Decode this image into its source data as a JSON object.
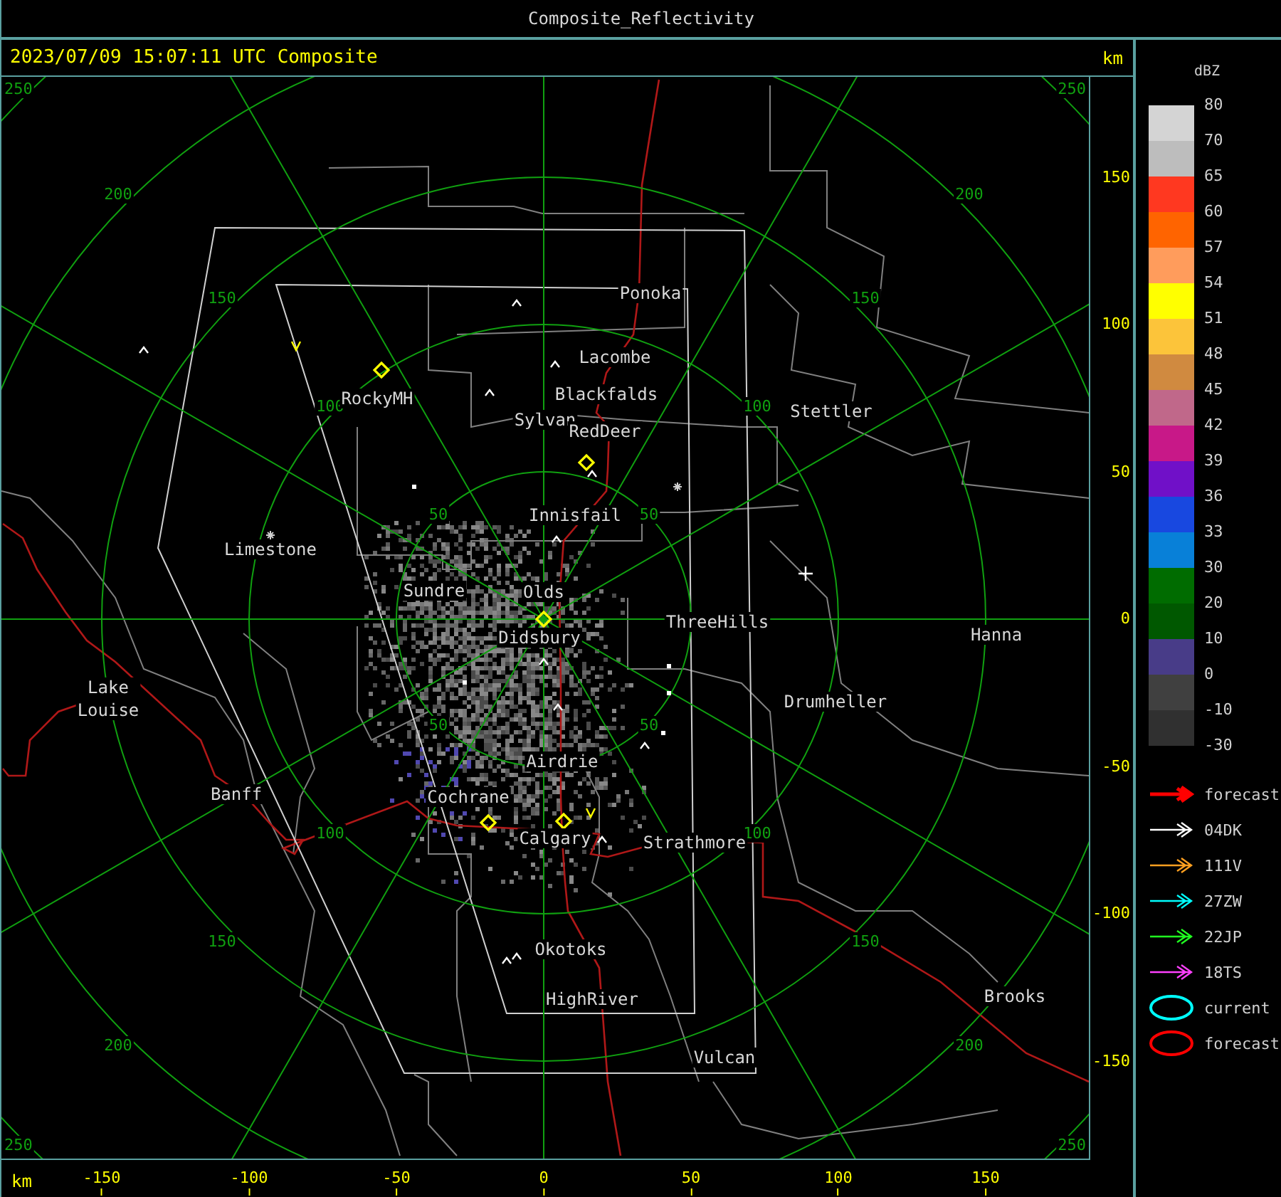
{
  "window": {
    "title": "Composite_Reflectivity"
  },
  "header": {
    "timestamp": "2023/07/09 15:07:11 UTC Composite",
    "unit": "km"
  },
  "map": {
    "range_rings": [
      {
        "labels": [
          "50",
          "50",
          "50",
          "50"
        ]
      },
      {
        "labels": [
          "100",
          "100",
          "100",
          "100"
        ]
      },
      {
        "labels": [
          "150",
          "150",
          "150",
          "150"
        ]
      },
      {
        "labels": [
          "200",
          "200",
          "200",
          "200"
        ]
      },
      {
        "labels": [
          "250",
          "250",
          "250",
          "250"
        ]
      }
    ],
    "cities": [
      {
        "name": "Ponoka"
      },
      {
        "name": "Lacombe"
      },
      {
        "name": "Blackfalds"
      },
      {
        "name": "Sylvan"
      },
      {
        "name": "RedDeer"
      },
      {
        "name": "RockyMH"
      },
      {
        "name": "Stettler"
      },
      {
        "name": "Innisfail"
      },
      {
        "name": "Limestone"
      },
      {
        "name": "Sundre"
      },
      {
        "name": "Olds"
      },
      {
        "name": "ThreeHills"
      },
      {
        "name": "Didsbury"
      },
      {
        "name": "Hanna"
      },
      {
        "name": "Lake Louise"
      },
      {
        "name": "Drumheller"
      },
      {
        "name": "Airdrie"
      },
      {
        "name": "Banff"
      },
      {
        "name": "Cochrane"
      },
      {
        "name": "Calgary"
      },
      {
        "name": "Strathmore"
      },
      {
        "name": "Okotoks"
      },
      {
        "name": "Brooks"
      },
      {
        "name": "HighRiver"
      },
      {
        "name": "Vulcan"
      }
    ]
  },
  "y_axis": {
    "ticks": [
      "150",
      "100",
      "50",
      "0",
      "-50",
      "-100",
      "-150"
    ]
  },
  "x_axis": {
    "unit": "km",
    "ticks": [
      "-150",
      "-100",
      "-50",
      "0",
      "50",
      "100",
      "150"
    ]
  },
  "legend": {
    "title": "dBZ",
    "labels": [
      "80",
      "70",
      "65",
      "60",
      "57",
      "54",
      "51",
      "48",
      "45",
      "42",
      "39",
      "36",
      "33",
      "30",
      "20",
      "10",
      "0",
      "-10",
      "-30"
    ],
    "bins": [
      {
        "color": "#d4d4d4"
      },
      {
        "color": "#bdbdbd"
      },
      {
        "color": "#ff3820"
      },
      {
        "color": "#ff6400"
      },
      {
        "color": "#ff9c5c"
      },
      {
        "color": "#ffff00"
      },
      {
        "color": "#fcc43a"
      },
      {
        "color": "#d08a40"
      },
      {
        "color": "#c0688a"
      },
      {
        "color": "#c81888"
      },
      {
        "color": "#7010c8"
      },
      {
        "color": "#1848e0"
      },
      {
        "color": "#0880d8"
      },
      {
        "color": "#006c00"
      },
      {
        "color": "#005800"
      },
      {
        "color": "#483c88"
      },
      {
        "color": "#404040"
      },
      {
        "color": "#303030"
      }
    ],
    "key": [
      {
        "kind": "forecast_arrow",
        "color": "#ff0000",
        "label": "forecast"
      },
      {
        "kind": "track_arrow",
        "color": "#ffffff",
        "label": "04DK"
      },
      {
        "kind": "track_arrow",
        "color": "#ffa020",
        "label": "111V"
      },
      {
        "kind": "track_arrow",
        "color": "#00ffff",
        "label": "27ZW"
      },
      {
        "kind": "track_arrow",
        "color": "#20ff20",
        "label": "22JP"
      },
      {
        "kind": "track_arrow",
        "color": "#ff40ff",
        "label": "18TS"
      },
      {
        "kind": "ellipse",
        "color": "#00ffff",
        "label": "current"
      },
      {
        "kind": "ellipse",
        "color": "#ff0000",
        "label": "forecast"
      }
    ]
  }
}
